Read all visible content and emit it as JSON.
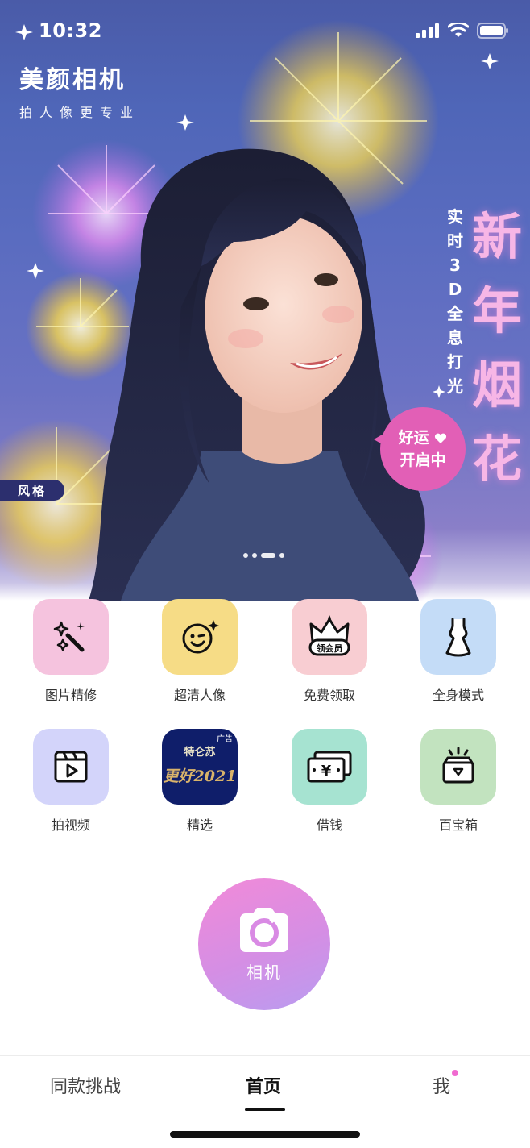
{
  "status_bar": {
    "time": "10:32",
    "icons": [
      "signal-icon",
      "wifi-icon",
      "battery-icon"
    ]
  },
  "brand": {
    "title": "美颜相机",
    "subtitle": "拍人像更专业"
  },
  "banner": {
    "headline_chars": [
      "新",
      "年",
      "烟",
      "花"
    ],
    "tagline_chars": [
      "实",
      "时",
      "3",
      "D",
      "全",
      "息",
      "打",
      "光"
    ],
    "badge_line1": "好运",
    "badge_line2": "开启中",
    "style_tag": "风格",
    "carousel": {
      "count": 4,
      "active_index": 2
    }
  },
  "features": [
    {
      "label": "图片精修",
      "icon": "magic-wand-icon",
      "bg": "#f5c3de"
    },
    {
      "label": "超清人像",
      "icon": "smile-face-icon",
      "bg": "#f6dc86"
    },
    {
      "label": "免费领取",
      "icon": "vip-crown-icon",
      "bg": "#f8cdd2",
      "crown_text": "领会员"
    },
    {
      "label": "全身模式",
      "icon": "dress-icon",
      "bg": "#c4dcf7"
    },
    {
      "label": "拍视频",
      "icon": "video-clapper-icon",
      "bg": "#d3d4fa"
    },
    {
      "label": "精选",
      "icon": "ad-thumbnail-icon",
      "bg": "#0f1e6a",
      "thumb_top": "特仑苏",
      "thumb_ad": "广告",
      "thumb_main": "更好2021"
    },
    {
      "label": "借钱",
      "icon": "cash-icon",
      "bg": "#a6e3d1",
      "cash_symbol": "¥"
    },
    {
      "label": "百宝箱",
      "icon": "treasure-box-icon",
      "bg": "#c2e3bf"
    }
  ],
  "camera": {
    "label": "相机",
    "icon": "camera-icon"
  },
  "tabs": [
    {
      "label": "同款挑战",
      "active": false
    },
    {
      "label": "首页",
      "active": true
    },
    {
      "label": "我",
      "active": false,
      "badge": true
    }
  ],
  "colors": {
    "accent_pink": "#e25fb6",
    "headline": "#f7b6e6",
    "tag_bg": "#2c2f6e"
  }
}
